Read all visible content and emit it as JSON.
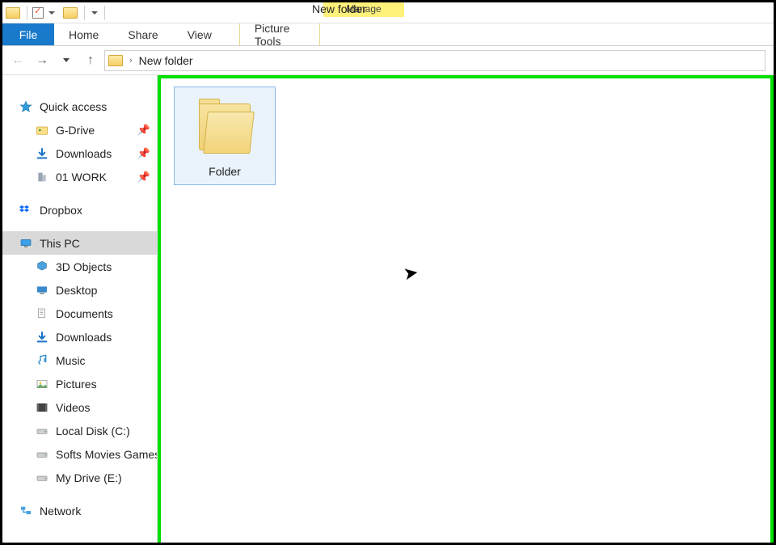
{
  "titlebar": {
    "manage_label": "Manage",
    "window_title": "New folder"
  },
  "ribbon": {
    "file": "File",
    "home": "Home",
    "share": "Share",
    "view": "View",
    "picture_tools": "Picture Tools"
  },
  "address": {
    "crumb": "New folder"
  },
  "sidebar": {
    "quick_access": "Quick access",
    "quick_items": [
      {
        "label": "G-Drive",
        "pinned": true
      },
      {
        "label": "Downloads",
        "pinned": true
      },
      {
        "label": "01 WORK",
        "pinned": true
      }
    ],
    "dropbox": "Dropbox",
    "this_pc": "This PC",
    "pc_items": [
      "3D Objects",
      "Desktop",
      "Documents",
      "Downloads",
      "Music",
      "Pictures",
      "Videos",
      "Local Disk (C:)",
      "Softs Movies Games",
      "My Drive (E:)"
    ],
    "network": "Network"
  },
  "content": {
    "items": [
      {
        "label": "Folder"
      }
    ]
  }
}
